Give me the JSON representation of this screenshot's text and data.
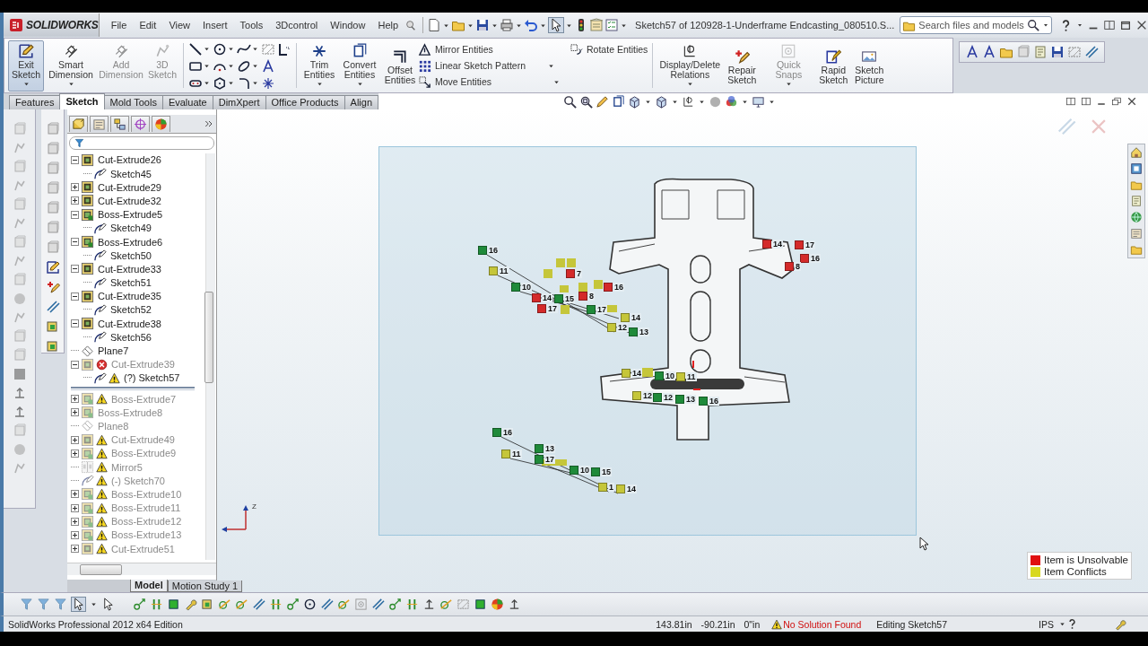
{
  "app": {
    "logo": "SOLIDWORKS",
    "menu": [
      "File",
      "Edit",
      "View",
      "Insert",
      "Tools",
      "3Dcontrol",
      "Window",
      "Help"
    ],
    "document_title": "Sketch57 of 120928-1-Underframe Endcasting_080510.S...",
    "search": {
      "placeholder": "Search files and models"
    }
  },
  "ribbon": {
    "sketch_buttons": [
      {
        "label": "Exit Sketch",
        "pressed": true,
        "disabled": false
      },
      {
        "label": "Smart Dimension",
        "pressed": false,
        "disabled": false
      },
      {
        "label": "Add Dimension",
        "pressed": false,
        "disabled": true
      },
      {
        "label": "3D Sketch",
        "pressed": false,
        "disabled": true
      }
    ],
    "edit_buttons": [
      {
        "label": "Trim Entities",
        "disabled": false
      },
      {
        "label": "Convert Entities",
        "disabled": false
      },
      {
        "label": "Offset Entities",
        "disabled": false
      }
    ],
    "list_buttons": [
      "Mirror Entities",
      "Linear Sketch Pattern",
      "Move Entities"
    ],
    "rotate_button": "Rotate Entities",
    "relation_buttons": [
      {
        "label": "Display/Delete Relations",
        "disabled": false
      },
      {
        "label": "Repair Sketch",
        "disabled": false
      },
      {
        "label": "Quick Snaps",
        "disabled": true
      },
      {
        "label": "Rapid Sketch",
        "disabled": false
      },
      {
        "label": "Sketch Picture",
        "disabled": false
      }
    ]
  },
  "command_tabs": [
    {
      "label": "Features",
      "selected": false
    },
    {
      "label": "Sketch",
      "selected": true
    },
    {
      "label": "Mold Tools",
      "selected": false
    },
    {
      "label": "Evaluate",
      "selected": false
    },
    {
      "label": "DimXpert",
      "selected": false
    },
    {
      "label": "Office Products",
      "selected": false
    },
    {
      "label": "Align",
      "selected": false
    }
  ],
  "feature_tree": {
    "items": [
      {
        "kind": "cut-extrude",
        "name": "Cut-Extrude26",
        "error": false,
        "warning": false,
        "dimmed": false,
        "expanded": true,
        "children": [
          {
            "kind": "sketch",
            "name": "Sketch45",
            "error": false,
            "warning": false,
            "dimmed": false
          }
        ]
      },
      {
        "kind": "cut-extrude",
        "name": "Cut-Extrude29",
        "error": false,
        "warning": false,
        "dimmed": false,
        "expanded": false
      },
      {
        "kind": "cut-extrude",
        "name": "Cut-Extrude32",
        "error": false,
        "warning": false,
        "dimmed": false,
        "expanded": false
      },
      {
        "kind": "boss-extrude",
        "name": "Boss-Extrude5",
        "error": false,
        "warning": false,
        "dimmed": false,
        "expanded": true,
        "children": [
          {
            "kind": "sketch",
            "name": "Sketch49",
            "error": false,
            "warning": false,
            "dimmed": false
          }
        ]
      },
      {
        "kind": "boss-extrude",
        "name": "Boss-Extrude6",
        "error": false,
        "warning": false,
        "dimmed": false,
        "expanded": true,
        "children": [
          {
            "kind": "sketch",
            "name": "Sketch50",
            "error": false,
            "warning": false,
            "dimmed": false
          }
        ]
      },
      {
        "kind": "cut-extrude",
        "name": "Cut-Extrude33",
        "error": false,
        "warning": false,
        "dimmed": false,
        "expanded": true,
        "children": [
          {
            "kind": "sketch",
            "name": "Sketch51",
            "error": false,
            "warning": false,
            "dimmed": false
          }
        ]
      },
      {
        "kind": "cut-extrude",
        "name": "Cut-Extrude35",
        "error": false,
        "warning": false,
        "dimmed": false,
        "expanded": true,
        "children": [
          {
            "kind": "sketch",
            "name": "Sketch52",
            "error": false,
            "warning": false,
            "dimmed": false
          }
        ]
      },
      {
        "kind": "cut-extrude",
        "name": "Cut-Extrude38",
        "error": false,
        "warning": false,
        "dimmed": false,
        "expanded": true,
        "children": [
          {
            "kind": "sketch",
            "name": "Sketch56",
            "error": false,
            "warning": false,
            "dimmed": false
          }
        ]
      },
      {
        "kind": "plane",
        "name": "Plane7",
        "error": false,
        "warning": false,
        "dimmed": false
      },
      {
        "kind": "cut-extrude",
        "name": "Cut-Extrude39",
        "error": true,
        "warning": false,
        "dimmed": true,
        "expanded": true,
        "children": [
          {
            "kind": "sketch",
            "name": "(?) Sketch57",
            "error": false,
            "warning": true,
            "dimmed": false
          }
        ]
      },
      {
        "kind": "rollback"
      },
      {
        "kind": "boss-extrude",
        "name": "Boss-Extrude7",
        "error": false,
        "warning": true,
        "dimmed": true,
        "expanded": false
      },
      {
        "kind": "boss-extrude",
        "name": "Boss-Extrude8",
        "error": false,
        "warning": false,
        "dimmed": true,
        "expanded": false
      },
      {
        "kind": "plane",
        "name": "Plane8",
        "error": false,
        "warning": false,
        "dimmed": true
      },
      {
        "kind": "cut-extrude",
        "name": "Cut-Extrude49",
        "error": false,
        "warning": true,
        "dimmed": true,
        "expanded": false
      },
      {
        "kind": "boss-extrude",
        "name": "Boss-Extrude9",
        "error": false,
        "warning": true,
        "dimmed": true,
        "expanded": false
      },
      {
        "kind": "mirror",
        "name": "Mirror5",
        "error": false,
        "warning": true,
        "dimmed": true
      },
      {
        "kind": "sketch",
        "name": "(-) Sketch70",
        "error": false,
        "warning": true,
        "dimmed": true
      },
      {
        "kind": "boss-extrude",
        "name": "Boss-Extrude10",
        "error": false,
        "warning": true,
        "dimmed": true,
        "expanded": false
      },
      {
        "kind": "boss-extrude",
        "name": "Boss-Extrude11",
        "error": false,
        "warning": true,
        "dimmed": true,
        "expanded": false
      },
      {
        "kind": "boss-extrude",
        "name": "Boss-Extrude12",
        "error": false,
        "warning": true,
        "dimmed": true,
        "expanded": false
      },
      {
        "kind": "boss-extrude",
        "name": "Boss-Extrude13",
        "error": false,
        "warning": true,
        "dimmed": true,
        "expanded": false
      },
      {
        "kind": "cut-extrude",
        "name": "Cut-Extrude51",
        "error": false,
        "warning": true,
        "dimmed": true,
        "expanded": false
      }
    ],
    "bottom_tabs": [
      {
        "label": "Model",
        "selected": true
      },
      {
        "label": "Motion Study 1",
        "selected": false
      }
    ]
  },
  "viewport": {
    "triad_label": "Z",
    "markers": [
      {
        "label": "16",
        "color": "#1f8a3a"
      },
      {
        "label": "11",
        "color": "#c5c63a"
      },
      {
        "label": "10",
        "color": "#1f8a3a"
      },
      {
        "label": "14",
        "color": "#d42a2a"
      },
      {
        "label": "15",
        "color": "#1f8a3a"
      },
      {
        "label": "17",
        "color": "#d42a2a"
      },
      {
        "label": "7",
        "color": "#d42a2a"
      },
      {
        "label": "16",
        "color": "#d42a2a"
      },
      {
        "label": "8",
        "color": "#d42a2a"
      },
      {
        "label": "17",
        "color": "#1f8a3a"
      },
      {
        "label": "14",
        "color": "#c5c63a"
      },
      {
        "label": "12",
        "color": "#c5c63a"
      },
      {
        "label": "13",
        "color": "#1f8a3a"
      },
      {
        "label": "14",
        "color": "#d42a2a"
      },
      {
        "label": "17",
        "color": "#d42a2a"
      },
      {
        "label": "16",
        "color": "#d42a2a"
      },
      {
        "label": "8",
        "color": "#d42a2a"
      },
      {
        "label": "14",
        "color": "#c5c63a"
      },
      {
        "label": "10",
        "color": "#1f8a3a"
      },
      {
        "label": "11",
        "color": "#c5c63a"
      },
      {
        "label": "12",
        "color": "#c5c63a"
      },
      {
        "label": "12",
        "color": "#1f8a3a"
      },
      {
        "label": "13",
        "color": "#1f8a3a"
      },
      {
        "label": "16",
        "color": "#1f8a3a"
      },
      {
        "label": "16",
        "color": "#1f8a3a"
      },
      {
        "label": "11",
        "color": "#c5c63a"
      },
      {
        "label": "13",
        "color": "#1f8a3a"
      },
      {
        "label": "17",
        "color": "#1f8a3a"
      },
      {
        "label": "10",
        "color": "#1f8a3a"
      },
      {
        "label": "15",
        "color": "#1f8a3a"
      },
      {
        "label": "1",
        "color": "#c5c63a"
      },
      {
        "label": "14",
        "color": "#c5c63a"
      }
    ],
    "legend": [
      {
        "label": "Item is Unsolvable",
        "color": "#e01010"
      },
      {
        "label": "Item Conflicts",
        "color": "#d8d820"
      }
    ]
  },
  "status_bar": {
    "edition": "SolidWorks Professional 2012 x64 Edition",
    "x": "143.81in",
    "y": "-90.21in",
    "z": "0\"in",
    "solve_status": "No Solution Found",
    "editing": "Editing Sketch57",
    "units": "IPS"
  }
}
